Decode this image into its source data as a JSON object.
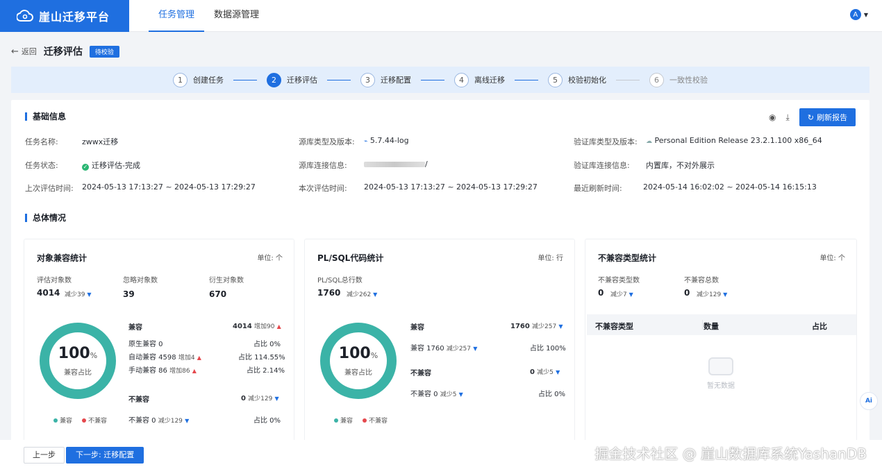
{
  "app": {
    "title": "崖山迁移平台"
  },
  "nav": {
    "tabs": [
      {
        "label": "任务管理"
      },
      {
        "label": "数据源管理"
      }
    ]
  },
  "header": {
    "back_label": "返回",
    "title": "迁移评估",
    "badge": "待校验"
  },
  "steps": [
    {
      "num": "1",
      "label": "创建任务"
    },
    {
      "num": "2",
      "label": "迁移评估"
    },
    {
      "num": "3",
      "label": "迁移配置"
    },
    {
      "num": "4",
      "label": "离线迁移"
    },
    {
      "num": "5",
      "label": "校验初始化"
    },
    {
      "num": "6",
      "label": "一致性校验"
    }
  ],
  "basic": {
    "title": "基础信息",
    "refresh_label": "刷新报告",
    "task_name_label": "任务名称:",
    "task_name": "zwwx迁移",
    "task_status_label": "任务状态:",
    "task_status": "迁移评估-完成",
    "last_eval_label": "上次评估时间:",
    "last_eval": "2024-05-13 17:13:27 ~ 2024-05-13 17:29:27",
    "src_type_label": "源库类型及版本:",
    "src_type": "5.7.44-log",
    "src_conn_label": "源库连接信息:",
    "src_conn_suffix": "/",
    "this_eval_label": "本次评估时间:",
    "this_eval": "2024-05-13 17:13:27 ~ 2024-05-13 17:29:27",
    "dst_type_label": "验证库类型及版本:",
    "dst_type": "Personal Edition Release 23.2.1.100 x86_64",
    "dst_conn_label": "验证库连接信息:",
    "dst_conn": "内置库，不对外展示",
    "refresh_time_label": "最近刷新时间:",
    "refresh_time": "2024-05-14 16:02:02 ~ 2024-05-14 16:15:13"
  },
  "overview": {
    "title": "总体情况"
  },
  "obj_card": {
    "title": "对象兼容统计",
    "unit": "单位: 个",
    "eval_label": "评估对象数",
    "eval_val": "4014",
    "eval_delta": "减少39",
    "ignore_label": "忽略对象数",
    "ignore_val": "39",
    "derive_label": "衍生对象数",
    "derive_val": "670",
    "pct": "100",
    "pct_sign": "%",
    "pct_label": "兼容占比",
    "compat_label": "兼容",
    "compat_val": "4014",
    "compat_delta": "增加90",
    "native_label": "原生兼容 0",
    "native_pct": "占比 0%",
    "auto_label": "自动兼容 4598",
    "auto_delta": "增加4",
    "auto_pct": "占比 114.55%",
    "manual_label": "手动兼容 86",
    "manual_delta": "增加86",
    "manual_pct": "占比 2.14%",
    "incompat_label": "不兼容",
    "incompat_val": "0",
    "incompat_delta": "减少129",
    "incompat_row_label": "不兼容 0",
    "incompat_row_delta": "减少129",
    "incompat_row_pct": "占比 0%",
    "legend_compat": "兼容",
    "legend_incompat": "不兼容"
  },
  "plsql_card": {
    "title": "PL/SQL代码统计",
    "unit": "单位: 行",
    "total_label": "PL/SQL总行数",
    "total_val": "1760",
    "total_delta": "减少262",
    "pct": "100",
    "pct_sign": "%",
    "pct_label": "兼容占比",
    "compat_label": "兼容",
    "compat_val": "1760",
    "compat_delta": "减少257",
    "compat_row_label": "兼容 1760",
    "compat_row_delta": "减少257",
    "compat_row_pct": "占比 100%",
    "incompat_label": "不兼容",
    "incompat_val": "0",
    "incompat_delta": "减少5",
    "incompat_row_label": "不兼容 0",
    "incompat_row_delta": "减少5",
    "incompat_row_pct": "占比 0%",
    "legend_compat": "兼容",
    "legend_incompat": "不兼容"
  },
  "incompat_card": {
    "title": "不兼容类型统计",
    "unit": "单位: 个",
    "type_label": "不兼容类型数",
    "type_val": "0",
    "type_delta": "减少7",
    "total_label": "不兼容总数",
    "total_val": "0",
    "total_delta": "减少129",
    "col_type": "不兼容类型",
    "col_count": "数量",
    "col_pct": "占比",
    "empty": "暂无数据"
  },
  "footer": {
    "prev": "上一步",
    "next": "下一步: 迁移配置",
    "watermark": "掘金技术社区 @ 崖山数据库系统YashanDB"
  },
  "colors": {
    "accent": "#1f6fe0",
    "compat": "#3bb3a7",
    "incompat": "#e5484d"
  }
}
